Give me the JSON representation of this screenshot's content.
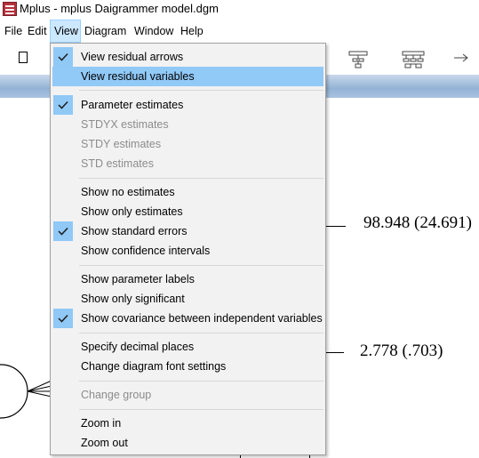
{
  "window": {
    "title": "Mplus - mplus Daigrammer model.dgm"
  },
  "menubar": {
    "items": [
      {
        "label": "File"
      },
      {
        "label": "Edit"
      },
      {
        "label": "View"
      },
      {
        "label": "Diagram"
      },
      {
        "label": "Window"
      },
      {
        "label": "Help"
      }
    ],
    "active": "View"
  },
  "view_menu": {
    "items": [
      {
        "label": "View residual arrows",
        "checked": true,
        "enabled": true
      },
      {
        "label": "View residual variables",
        "checked": false,
        "enabled": true,
        "highlighted": true
      },
      {
        "label": "Parameter estimates",
        "checked": true,
        "enabled": true
      },
      {
        "label": "STDYX estimates",
        "checked": false,
        "enabled": false
      },
      {
        "label": "STDY estimates",
        "checked": false,
        "enabled": false
      },
      {
        "label": "STD estimates",
        "checked": false,
        "enabled": false
      },
      {
        "label": "Show no estimates",
        "checked": false,
        "enabled": true
      },
      {
        "label": "Show only estimates",
        "checked": false,
        "enabled": true
      },
      {
        "label": "Show standard errors",
        "checked": true,
        "enabled": true
      },
      {
        "label": "Show confidence intervals",
        "checked": false,
        "enabled": true
      },
      {
        "label": "Show parameter labels",
        "checked": false,
        "enabled": true
      },
      {
        "label": "Show only significant",
        "checked": false,
        "enabled": true
      },
      {
        "label": "Show covariance between independent variables",
        "checked": true,
        "enabled": true
      },
      {
        "label": "Specify decimal places",
        "checked": false,
        "enabled": true
      },
      {
        "label": "Change diagram font settings",
        "checked": false,
        "enabled": true
      },
      {
        "label": "Change group",
        "checked": false,
        "enabled": false
      },
      {
        "label": "Zoom in",
        "checked": false,
        "enabled": true
      },
      {
        "label": "Zoom out",
        "checked": false,
        "enabled": true
      }
    ]
  },
  "diagram": {
    "estimate_1": "98.948 (24.691)",
    "estimate_2": "2.778 (.703)"
  },
  "colors": {
    "menu_highlight": "#91c9f7",
    "check_bg": "#90c8f6",
    "active_menu_bg": "#cce8ff",
    "band": "#93b3d6"
  },
  "icons": [
    "app-icon",
    "new-document-icon",
    "tree-diagram-icon",
    "tree-diagram-2-icon",
    "right-arrow-icon",
    "checkmark-icon"
  ]
}
